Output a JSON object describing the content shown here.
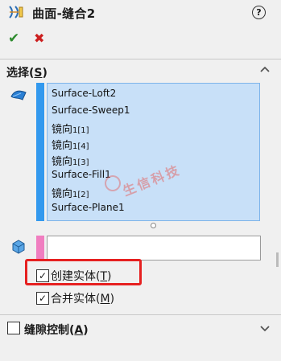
{
  "header": {
    "title": "曲面-缝合2",
    "help_label": "?",
    "ok_icon": "✔",
    "cancel_icon": "✖",
    "feature_icon": "surface-knit-icon"
  },
  "selection": {
    "title": "选择(S)",
    "title_main": "选择(",
    "title_key": "S",
    "title_end": ")",
    "items": [
      {
        "name": "Surface-Loft2"
      },
      {
        "name": "Surface-Sweep1"
      },
      {
        "main": "镜向",
        "suffix": "1[1]"
      },
      {
        "main": "镜向",
        "suffix": "1[4]"
      },
      {
        "main": "镜向",
        "suffix": "1[3]"
      },
      {
        "name": "Surface-Fill1"
      },
      {
        "main": "镜向",
        "suffix": "1[2]"
      },
      {
        "name": "Surface-Plane1"
      }
    ],
    "second_box_value": ""
  },
  "options": {
    "create_solid": {
      "main": "创建实体(",
      "key": "T",
      "end": ")",
      "checked": true
    },
    "merge_entities": {
      "main": "合并实体(",
      "key": "M",
      "end": ")",
      "checked": true
    }
  },
  "gap_control": {
    "title_main": "缝隙控制(",
    "title_key": "A",
    "title_end": ")",
    "checked": false
  },
  "watermark": {
    "text": "生信科技"
  },
  "colors": {
    "list_bg": "#c8e0f8",
    "list_selector": "#3399ee",
    "second_selector": "#f07ec0",
    "highlight_box": "#e62020",
    "ok_green": "#2e8b2e",
    "cancel_red": "#cc1f1f"
  }
}
